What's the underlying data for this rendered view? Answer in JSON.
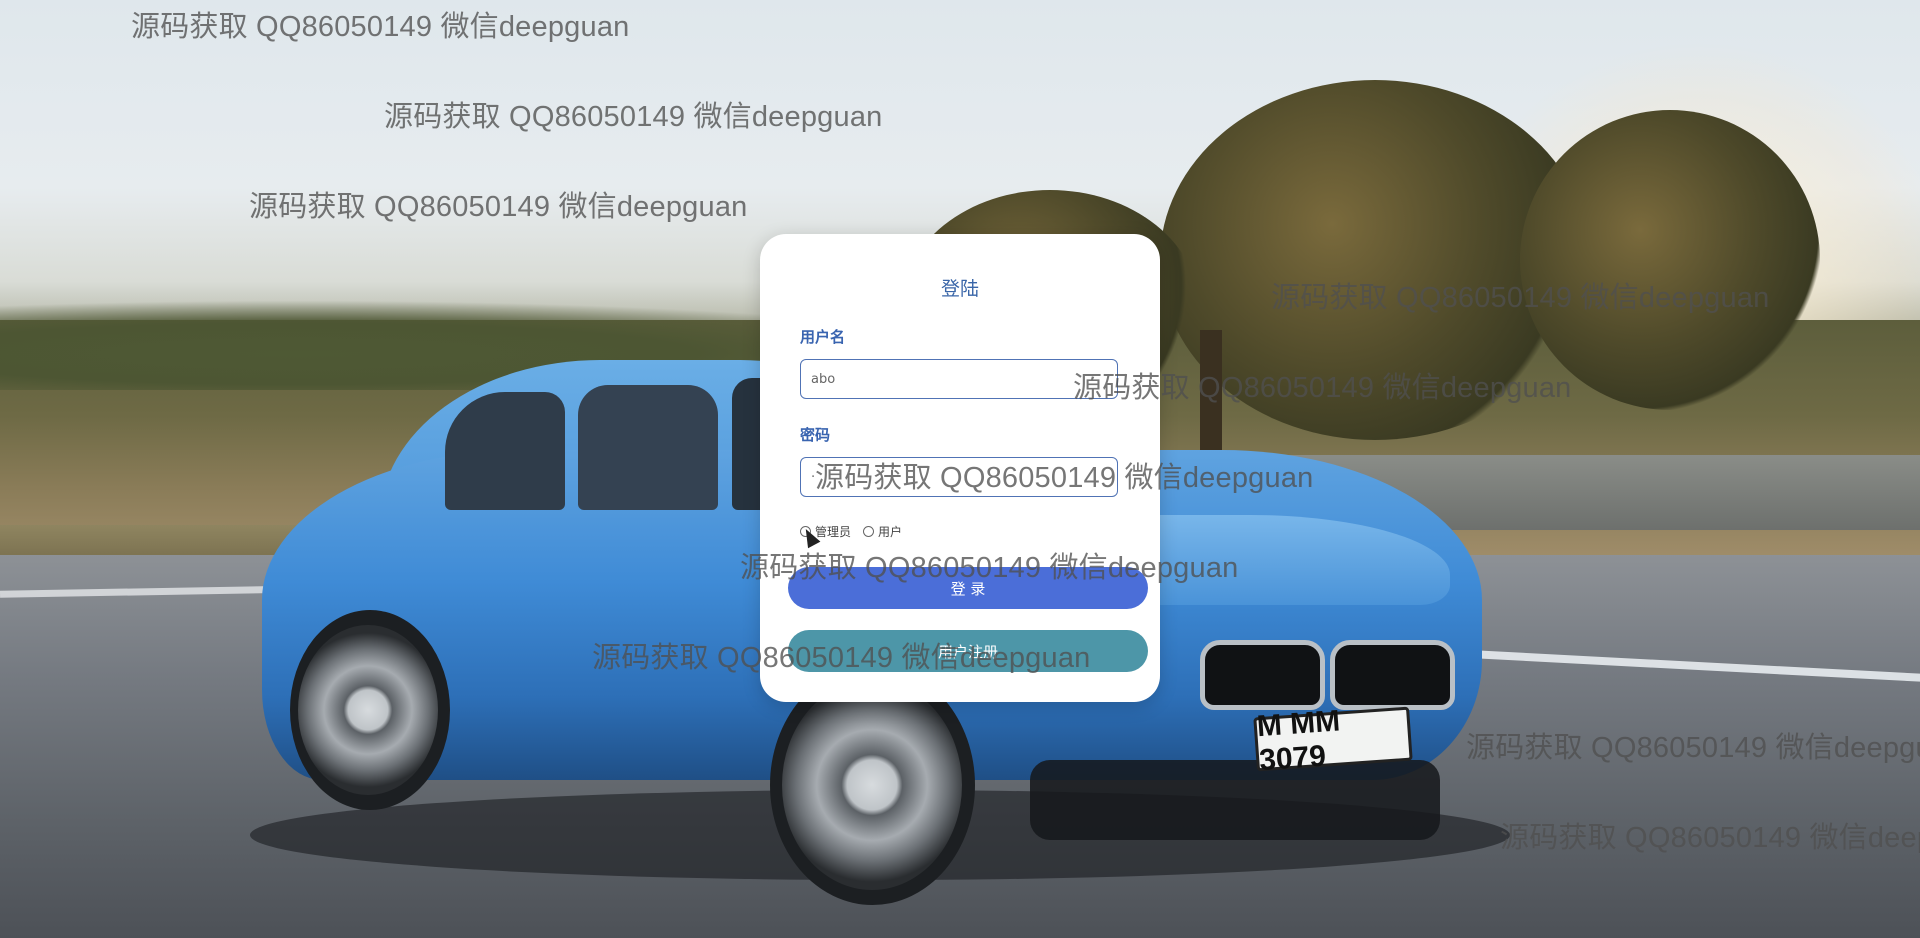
{
  "login": {
    "title": "登陆",
    "username_label": "用户名",
    "username_value": "abo",
    "password_label": "密码",
    "password_value": "·",
    "roles": [
      "管理员",
      "用户"
    ],
    "login_button": "登 录",
    "register_button": "用户注册"
  },
  "background": {
    "plate": "M MM 3079"
  },
  "watermark_text": "源码获取 QQ86050149 微信deepguan"
}
